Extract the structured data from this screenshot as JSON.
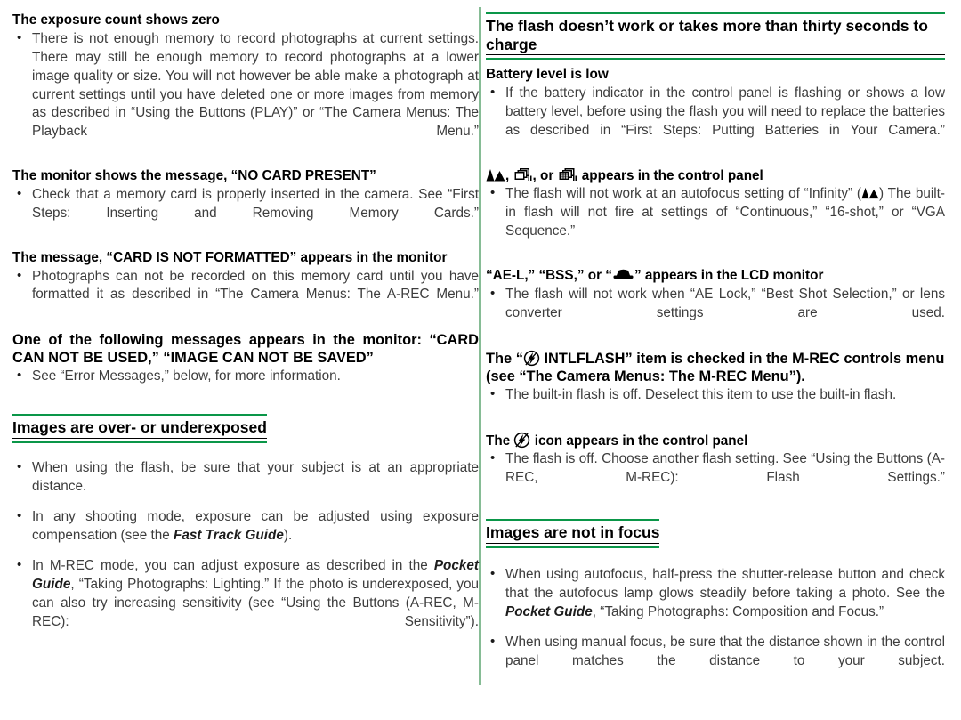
{
  "theme": {
    "rule_green": "#0a9648",
    "divider_green": "#86bc95",
    "body_text": "#3d3d3d",
    "heading_text": "#000000"
  },
  "left_column": {
    "blocks": [
      {
        "type": "sub_heading",
        "heading": "The exposure count shows zero",
        "bullets": [
          "There is not enough memory to record photographs at current settings. There may still be enough memory to record photographs at a lower image quality or size.  You will not however be able make a photograph at current settings until you have deleted one or more images from memory as described in “Using the Buttons (PLAY)” or “The Camera Menus: The Playback Menu.”"
        ]
      },
      {
        "type": "sub_heading",
        "heading": "The monitor shows the message, “NO CARD PRESENT”",
        "bullets": [
          "Check that a memory card is properly inserted in the camera. See “First Steps: Inserting and Removing Memory Cards.”"
        ]
      },
      {
        "type": "sub_heading",
        "heading": "The message, “CARD IS NOT FORMATTED” appears in the monitor",
        "bullets": [
          "Photographs can not be recorded on this memory card until you have formatted it as described in “The Camera Menus: The A-REC Menu.”"
        ]
      },
      {
        "type": "sub_heading",
        "heading": "One of the following messages appears in the monitor: “CARD CAN NOT BE USED,” “IMAGE CAN NOT BE SAVED”",
        "bullets": [
          "See “Error Messages,” below, for more information."
        ]
      },
      {
        "type": "section_heading",
        "heading": "Images are over- or underexposed",
        "bullets": [
          "When using the flash, be sure that your subject is at an appropriate distance.",
          "In any shooting mode, exposure can be adjusted using exposure compensation (see the Fast Track Guide).",
          "In M-REC mode, you can adjust exposure as described in the Pocket Guide, “Taking Photographs: Lighting.”  If the photo is underexposed, you can also try increasing sensitivity (see “Using the Buttons (A-REC, M-REC): Sensitivity”)."
        ]
      }
    ]
  },
  "right_column": {
    "section_heading": "The flash doesn’t work or takes more than thirty seconds to charge",
    "blocks": [
      {
        "heading": "Battery level is low",
        "bullets": [
          "If the battery indicator in the control panel is flashing or shows a low battery level, before using the flash you will need to replace the batteries as described in “First Steps: Putting Batteries in Your Camera.”"
        ]
      },
      {
        "heading_parts": {
          "sep1": ", ",
          "sep2": ", or ",
          "tail": " appears in the control panel"
        },
        "heading_icons": [
          "mountain-infinity-icon",
          "continuous-shooting-icon",
          "grid-sequence-icon"
        ],
        "bullet_lead": "The flash will not work at an autofocus setting of “Infinity” (",
        "bullet_tail": ") The built-in flash will not fire at settings of “Continuous,” “16-shot,” or “VGA Sequence.”"
      },
      {
        "heading_lead": "“AE-L,” “BSS,” or “",
        "heading_tail": "” appears in the LCD monitor",
        "heading_icon": "lens-converter-icon",
        "bullets": [
          "The flash will not work when “AE Lock,” “Best Shot Selection,” or lens converter settings are used."
        ]
      },
      {
        "heading_lead": "The “",
        "heading_tail": " INTLFLASH” item is checked in the M-REC controls menu (see “The Camera Menus: The M-REC Menu”).",
        "heading_icon": "flash-cancel-icon",
        "bullets": [
          "The built-in flash is off.  Deselect this item to use the built-in flash."
        ]
      },
      {
        "heading_lead": "The ",
        "heading_tail": " icon appears in the control panel",
        "heading_icon": "flash-cancel-icon",
        "bullets": [
          "The flash is off.  Choose another flash setting.  See “Using the Buttons (A-REC, M-REC): Flash Settings.”"
        ]
      }
    ],
    "focus_section": {
      "heading": "Images are not in focus",
      "bullets": [
        "When using autofocus, half-press the shutter-release button and check that the autofocus lamp glows steadily before taking a photo.  See the Pocket Guide, “Taking Photographs: Composition and Focus.”",
        "When using manual focus, be sure that the distance shown in the control panel matches the distance to your subject."
      ]
    }
  }
}
